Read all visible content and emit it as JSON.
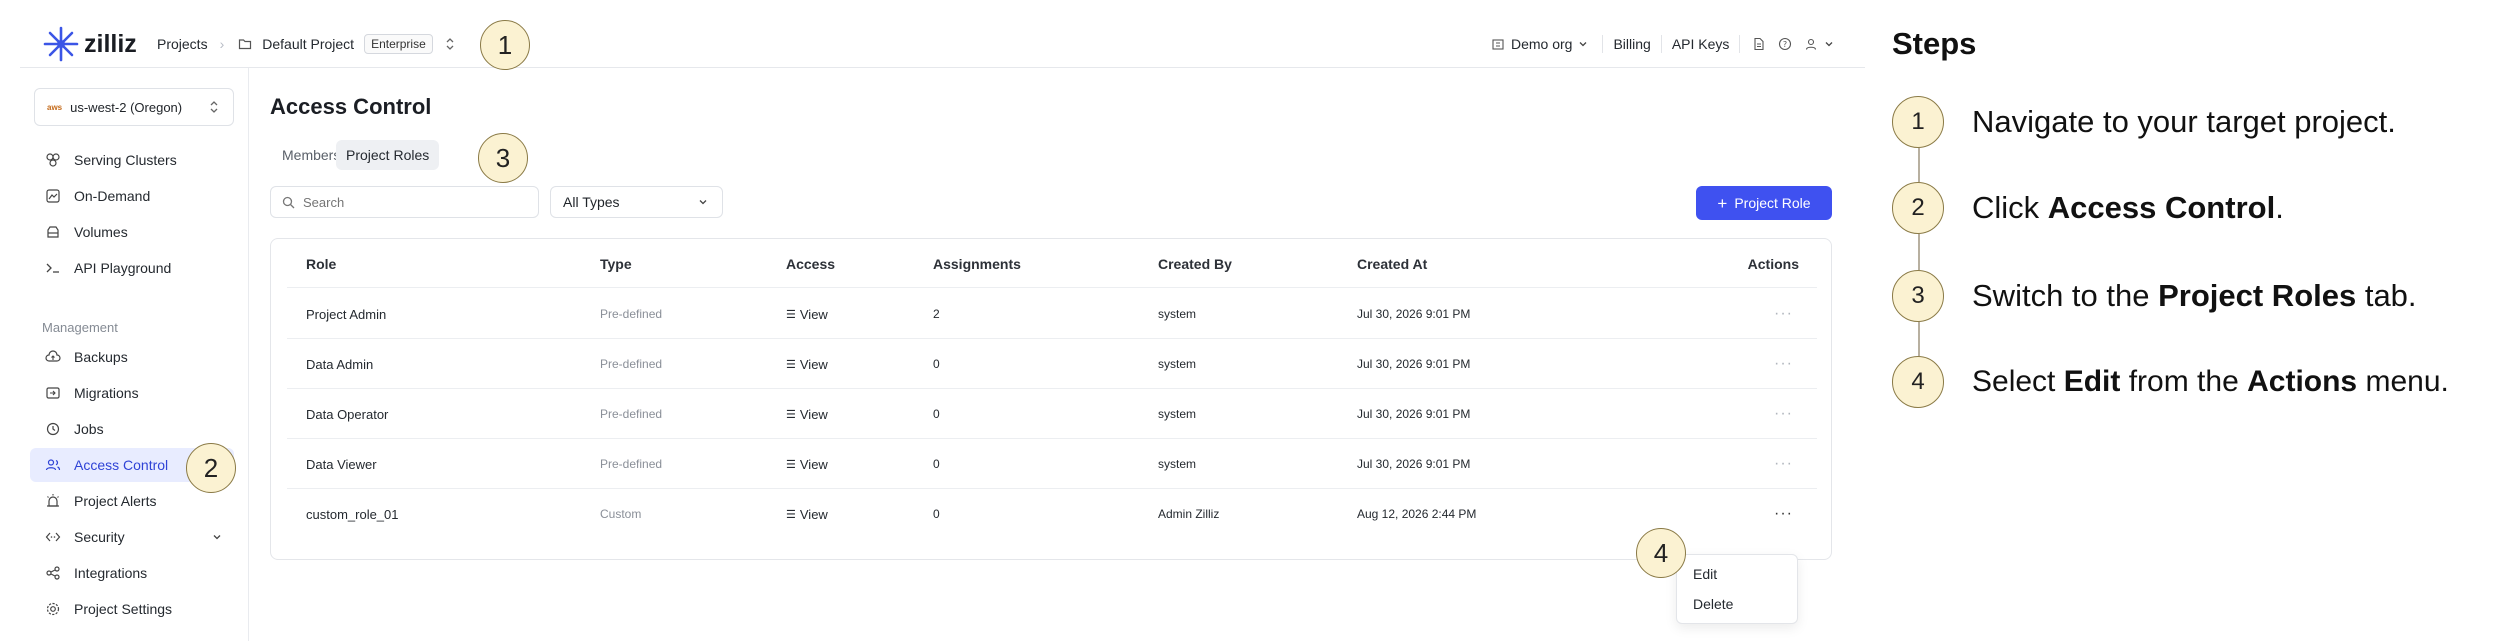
{
  "topbar": {
    "logo_text": "zilliz",
    "breadcrumb_projects": "Projects",
    "project_name": "Default Project",
    "plan_badge": "Enterprise",
    "org_label": "Demo org",
    "billing": "Billing",
    "api_keys": "API Keys"
  },
  "sidebar": {
    "region": "us-west-2 (Oregon)",
    "items": [
      "Serving Clusters",
      "On-Demand",
      "Volumes",
      "API Playground"
    ],
    "section_title": "Management",
    "mgmt_items": [
      "Backups",
      "Migrations",
      "Jobs",
      "Access Control",
      "Project Alerts",
      "Security",
      "Integrations",
      "Project Settings"
    ]
  },
  "main": {
    "title": "Access Control",
    "tabs": [
      "Members",
      "Project Roles"
    ],
    "search_placeholder": "Search",
    "type_filter": "All Types",
    "add_role_button": "Project Role",
    "columns": [
      "Role",
      "Type",
      "Access",
      "Assignments",
      "Created By",
      "Created At",
      "Actions"
    ],
    "rows": [
      {
        "role": "Project Admin",
        "type": "Pre-defined",
        "access": "View",
        "assignments": "2",
        "created_by": "system",
        "created_at": "Jul 30, 2026 9:01 PM"
      },
      {
        "role": "Data Admin",
        "type": "Pre-defined",
        "access": "View",
        "assignments": "0",
        "created_by": "system",
        "created_at": "Jul 30, 2026 9:01 PM"
      },
      {
        "role": "Data Operator",
        "type": "Pre-defined",
        "access": "View",
        "assignments": "0",
        "created_by": "system",
        "created_at": "Jul 30, 2026 9:01 PM"
      },
      {
        "role": "Data Viewer",
        "type": "Pre-defined",
        "access": "View",
        "assignments": "0",
        "created_by": "system",
        "created_at": "Jul 30, 2026 9:01 PM"
      },
      {
        "role": "custom_role_01",
        "type": "Custom",
        "access": "View",
        "assignments": "0",
        "created_by": "Admin Zilliz",
        "created_at": "Aug 12, 2026 2:44 PM"
      }
    ],
    "menu": {
      "edit": "Edit",
      "delete": "Delete"
    }
  },
  "callouts": {
    "c1": "1",
    "c2": "2",
    "c3": "3",
    "c4": "4"
  },
  "steps": {
    "title": "Steps",
    "items": [
      {
        "num": "1",
        "pre": "Navigate to your target project.",
        "bold": "",
        "mid": "",
        "bold2": "",
        "post": ""
      },
      {
        "num": "2",
        "pre": "Click ",
        "bold": "Access Control",
        "mid": ".",
        "bold2": "",
        "post": ""
      },
      {
        "num": "3",
        "pre": "Switch to the ",
        "bold": "Project Roles",
        "mid": " tab.",
        "bold2": "",
        "post": ""
      },
      {
        "num": "4",
        "pre": "Select ",
        "bold": "Edit",
        "mid": " from the ",
        "bold2": "Actions",
        "post": " menu."
      }
    ]
  },
  "colors": {
    "accent": "#3f51f0",
    "active_bg": "#e8ecff",
    "callout_fill": "#fbf2d2",
    "callout_border": "#8a7a46"
  }
}
